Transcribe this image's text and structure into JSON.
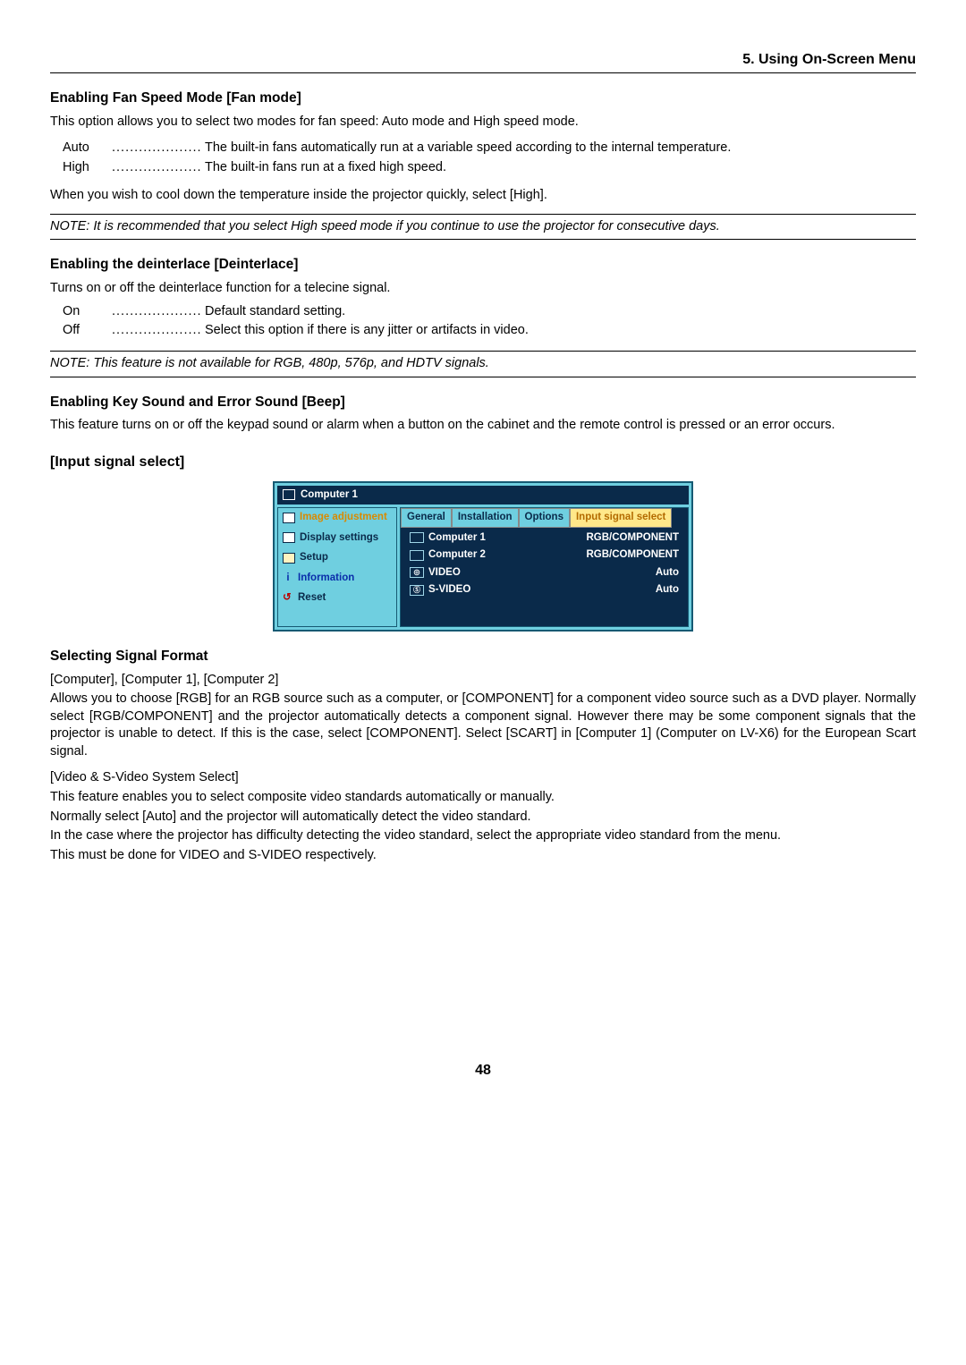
{
  "chapter": "5. Using On-Screen Menu",
  "fan": {
    "heading": "Enabling Fan Speed Mode [Fan mode]",
    "intro": "This option allows you to select two modes for fan speed: Auto mode and High speed mode.",
    "auto_term": "Auto",
    "auto_desc": "The built-in fans automatically run at a variable speed according to the internal temperature.",
    "high_term": "High",
    "high_desc": "The built-in fans run at a fixed high speed.",
    "outro": "When you wish to cool down the temperature inside the projector quickly, select [High].",
    "note": "NOTE: It is recommended that you select High speed mode if you continue to use the projector for consecutive days."
  },
  "deint": {
    "heading": "Enabling the deinterlace [Deinterlace]",
    "intro": "Turns on or off the deinterlace function for a telecine signal.",
    "on_term": "On",
    "on_desc": "Default standard setting.",
    "off_term": "Off",
    "off_desc": "Select this option if there is any jitter or artifacts in video.",
    "note": "NOTE: This feature is not available for RGB, 480p, 576p, and HDTV signals."
  },
  "beep": {
    "heading": "Enabling Key Sound and Error Sound [Beep]",
    "body": "This feature turns on or off the keypad sound or alarm when a button on the cabinet and the remote control is pressed or an error occurs."
  },
  "input_heading": "[Input signal select]",
  "osd": {
    "title": "Computer 1",
    "side": {
      "image_adj": "Image adjustment",
      "display": "Display settings",
      "setup": "Setup",
      "info": "Information",
      "reset": "Reset"
    },
    "tabs": {
      "general": "General",
      "installation": "Installation",
      "options": "Options",
      "input": "Input signal select"
    },
    "rows": [
      {
        "label": "Computer 1",
        "value": "RGB/COMPONENT"
      },
      {
        "label": "Computer 2",
        "value": "RGB/COMPONENT"
      },
      {
        "label": "VIDEO",
        "value": "Auto"
      },
      {
        "label": "S-VIDEO",
        "value": "Auto"
      }
    ]
  },
  "sigfmt": {
    "heading": "Selecting Signal Format",
    "l1": "[Computer], [Computer 1], [Computer 2]",
    "l2": "Allows you to choose [RGB] for an RGB source such as a computer, or [COMPONENT] for a component video source such as a DVD player. Normally select [RGB/COMPONENT] and the projector automatically detects a component signal. However there may be some component signals that the projector is unable to detect. If this is the case, select [COMPONENT]. Select [SCART] in [Computer 1] (Computer on LV-X6) for the European Scart signal.",
    "l3": "[Video & S-Video System Select]",
    "l4": "This feature enables you to select composite video standards automatically or manually.",
    "l5": "Normally select [Auto] and the projector will automatically detect the video standard.",
    "l6": "In the case where the projector has difficulty detecting the video standard, select the appropriate video standard from the menu.",
    "l7": "This must be done for VIDEO and S-VIDEO respectively."
  },
  "page_number": "48"
}
